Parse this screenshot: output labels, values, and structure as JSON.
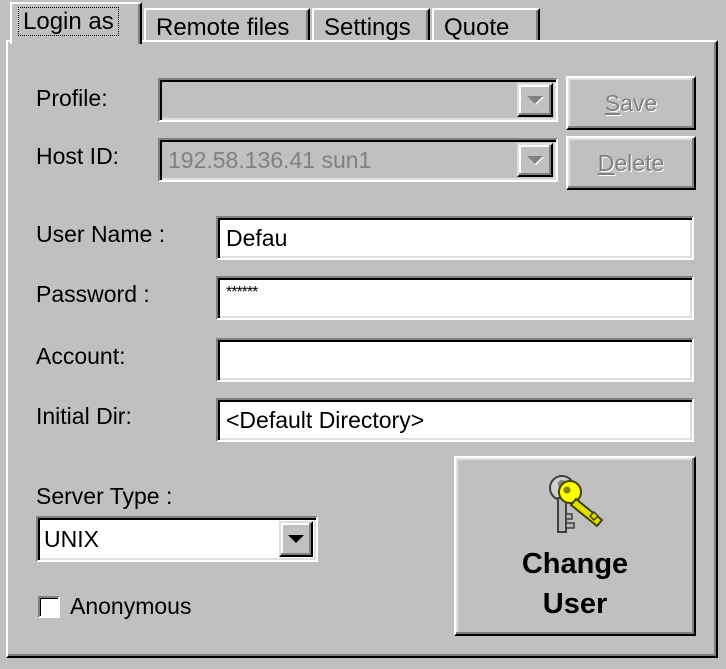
{
  "tabs": [
    {
      "label": "Login as"
    },
    {
      "label": "Remote files"
    },
    {
      "label": "Settings"
    },
    {
      "label": "Quote"
    }
  ],
  "form": {
    "profile_label": "Profile:",
    "profile_value": "",
    "host_label": "Host ID:",
    "host_value": "192.58.136.41 sun1",
    "save_label": "Save",
    "delete_label": "Delete",
    "username_label": "User Name :",
    "username_value": "Defau",
    "password_label": "Password :",
    "password_value": "******",
    "account_label": "Account:",
    "account_value": "",
    "initial_dir_label": "Initial Dir:",
    "initial_dir_value": "<Default Directory>",
    "server_type_label": "Server Type :",
    "server_type_value": "UNIX",
    "anonymous_label": "Anonymous",
    "anonymous_checked": false,
    "change_user_line1": "Change",
    "change_user_line2": "User",
    "change_user_icon": "keys-icon"
  }
}
